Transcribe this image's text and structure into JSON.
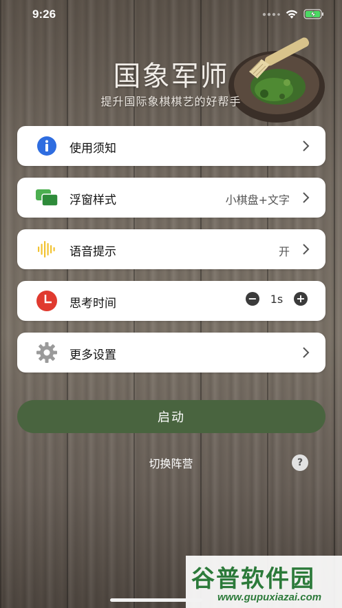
{
  "status_bar": {
    "time": "9:26"
  },
  "app": {
    "title": "国象军师",
    "subtitle": "提升国际象棋棋艺的好帮手"
  },
  "menu": {
    "items": [
      {
        "label": "使用须知",
        "value": "",
        "icon": "info-icon"
      },
      {
        "label": "浮窗样式",
        "value": "小棋盘+文字",
        "icon": "float-window-icon"
      },
      {
        "label": "语音提示",
        "value": "开",
        "icon": "voice-wave-icon"
      },
      {
        "label": "思考时间",
        "value": "1s",
        "icon": "clock-icon"
      },
      {
        "label": "更多设置",
        "value": "",
        "icon": "gear-icon"
      }
    ]
  },
  "stepper": {
    "minus": "−",
    "plus": "+"
  },
  "start_button": {
    "label": "启动"
  },
  "switch_camp": {
    "label": "切换阵营"
  },
  "help": {
    "label": "?"
  },
  "watermark": {
    "big": "谷普软件园",
    "small": "www.gupuxiazai.com"
  },
  "colors": {
    "accent": "#49643f",
    "info_blue": "#2f6de0",
    "float_green": "#4caf50",
    "voice_yellow": "#f2c230",
    "clock_red": "#e03a2f",
    "gear_gray": "#9a9a9a"
  }
}
